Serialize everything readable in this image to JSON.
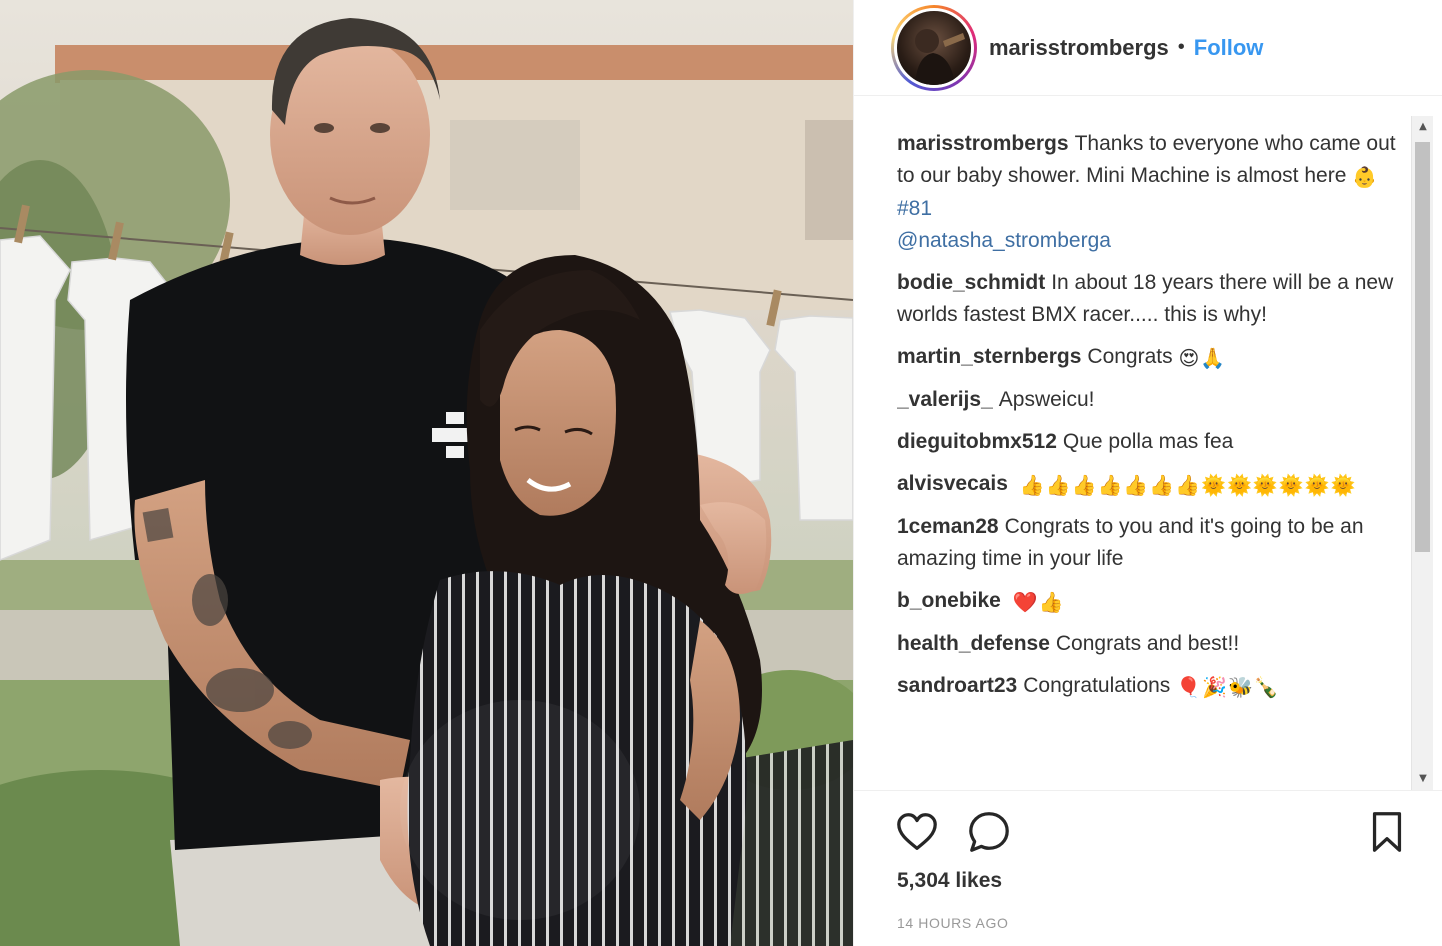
{
  "post": {
    "username": "marisstrombergs",
    "separator": "•",
    "follow_label": "Follow",
    "likes": "5,304 likes",
    "timestamp": "14 HOURS AGO"
  },
  "comments": [
    {
      "user": "marisstrombergs",
      "text": "Thanks to everyone who came out to our baby shower. Mini Machine is almost here",
      "emoji": "👶",
      "hashtag": "#81",
      "mention": "@natasha_stromberga"
    },
    {
      "user": "bodie_schmidt",
      "text": "In about 18 years there will be a new worlds fastest BMX racer..... this is why!"
    },
    {
      "user": "martin_sternbergs",
      "text": "Congrats",
      "emoji": "😍🙏"
    },
    {
      "user": "_valerijs_",
      "text": "Apsweicu!"
    },
    {
      "user": "dieguitobmx512",
      "text": "Que polla mas fea"
    },
    {
      "user": "alvisvecais",
      "text": "",
      "emoji": "👍👍👍👍👍👍👍🌞🌞🌞🌞🌞🌞"
    },
    {
      "user": "1ceman28",
      "text": "Congrats to you and it's going to be an amazing time in your life"
    },
    {
      "user": "b_onebike",
      "text": "",
      "emoji": "❤️👍"
    },
    {
      "user": "health_defense",
      "text": "Congrats and best!!"
    },
    {
      "user": "sandroart23",
      "text": "Congratulations",
      "emoji": "🎈🎉🐝🍾"
    }
  ],
  "icons": {
    "like": "heart-icon",
    "comment": "comment-icon",
    "save": "bookmark-icon"
  },
  "colors": {
    "follow": "#3897f0",
    "text": "#262626",
    "muted": "#999999"
  }
}
